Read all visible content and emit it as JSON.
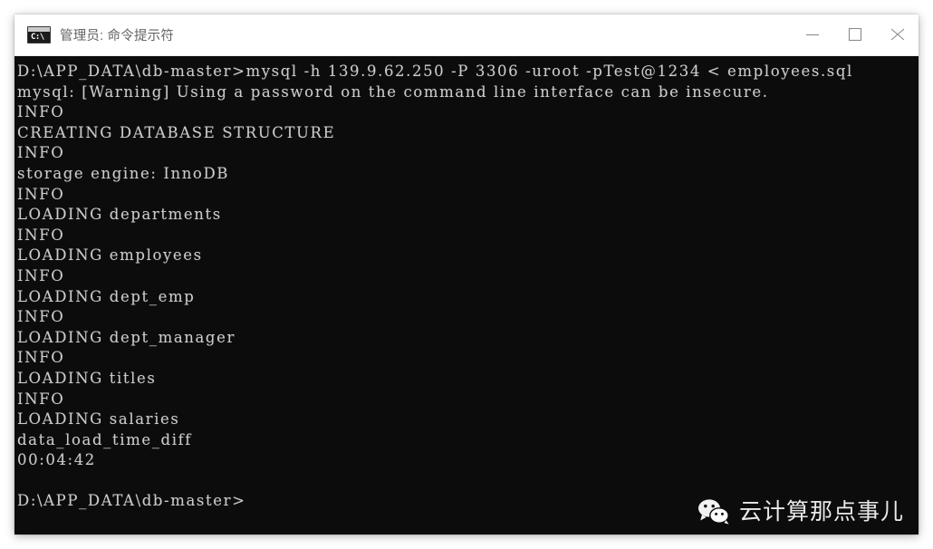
{
  "window": {
    "title": "管理员: 命令提示符",
    "icon": "cmd-console-icon",
    "icon_glyph": "C:\\",
    "background_color": "#0c0c0c",
    "text_color": "#cccccc",
    "titlebar_color": "#ffffff",
    "title_text_color": "#646464",
    "controls": {
      "minimize_label": "最小化",
      "maximize_label": "最大化",
      "close_label": "关闭"
    }
  },
  "terminal": {
    "lines": [
      "D:\\APP_DATA\\db-master>mysql -h 139.9.62.250 -P 3306 -uroot -pTest@1234 < employees.sql",
      "mysql: [Warning] Using a password on the command line interface can be insecure.",
      "INFO",
      "CREATING DATABASE STRUCTURE",
      "INFO",
      "storage engine: InnoDB",
      "INFO",
      "LOADING departments",
      "INFO",
      "LOADING employees",
      "INFO",
      "LOADING dept_emp",
      "INFO",
      "LOADING dept_manager",
      "INFO",
      "LOADING titles",
      "INFO",
      "LOADING salaries",
      "data_load_time_diff",
      "00:04:42",
      "",
      "D:\\APP_DATA\\db-master>"
    ],
    "prompt": "D:\\APP_DATA\\db-master>",
    "command": "mysql -h 139.9.62.250 -P 3306 -uroot -pTest@1234 < employees.sql",
    "host": "139.9.62.250",
    "port": "3306",
    "user": "root",
    "password": "Test@1234",
    "sql_file": "employees.sql",
    "storage_engine": "InnoDB",
    "elapsed_time": "00:04:42",
    "loaded_tables": [
      "departments",
      "employees",
      "dept_emp",
      "dept_manager",
      "titles",
      "salaries"
    ]
  },
  "watermark": {
    "text": "云计算那点事儿",
    "icon": "wechat-logo",
    "color": "#e9e9e9"
  }
}
